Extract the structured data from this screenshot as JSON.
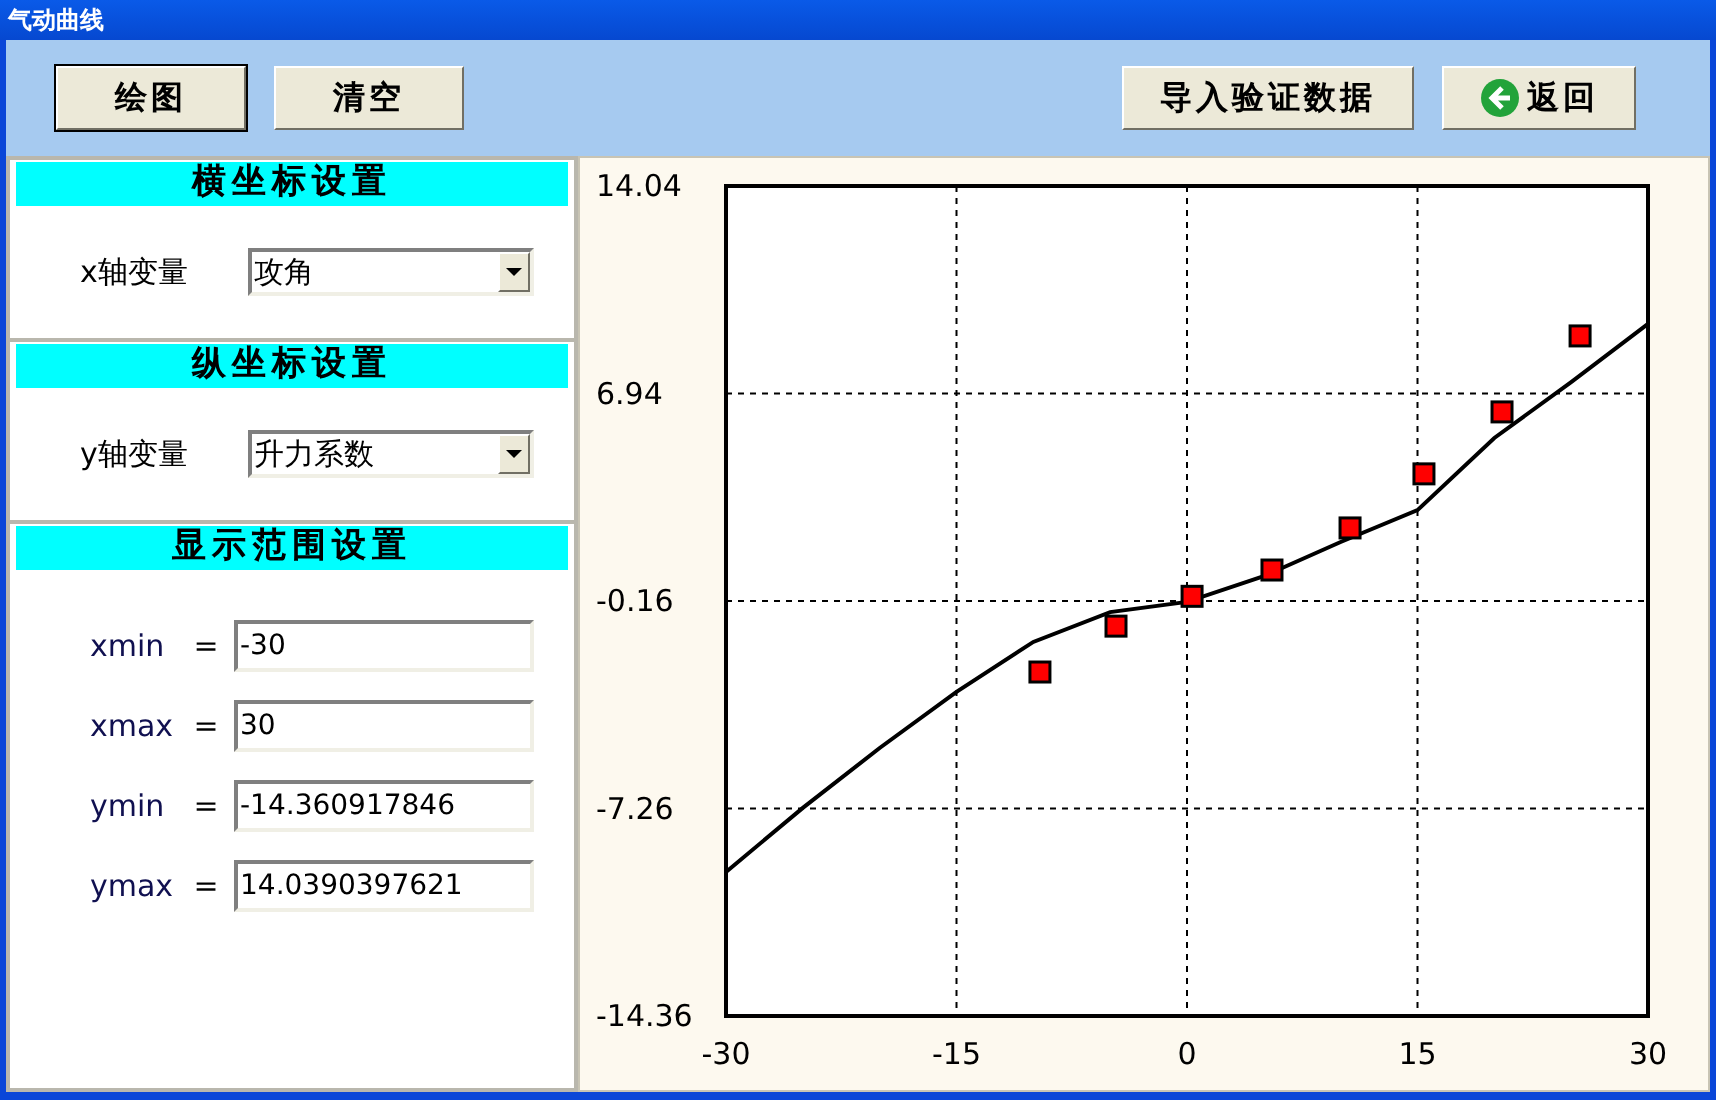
{
  "window": {
    "title": "气动曲线"
  },
  "toolbar": {
    "left_buttons": [
      {
        "label": "绘图",
        "focused": true
      },
      {
        "label": "清空",
        "focused": false
      }
    ],
    "right_buttons": [
      {
        "label": "导入验证数据",
        "icon": false
      },
      {
        "label": "返回",
        "icon": true
      }
    ]
  },
  "sections": [
    {
      "title": "横坐标设置",
      "kind": "select",
      "label": "x轴变量",
      "value": "攻角"
    },
    {
      "title": "纵坐标设置",
      "kind": "select",
      "label": "y轴变量",
      "value": "升力系数"
    },
    {
      "title": "显示范围设置",
      "kind": "range",
      "fields": [
        {
          "label": "xmin",
          "equals": "=",
          "value": "-30"
        },
        {
          "label": "xmax",
          "equals": "=",
          "value": "30"
        },
        {
          "label": "ymin",
          "equals": "=",
          "value": "-14.360917846"
        },
        {
          "label": "ymax",
          "equals": "=",
          "value": "14.0390397621"
        }
      ]
    }
  ],
  "chart_data": {
    "type": "line",
    "grid": true,
    "xlim": [
      -30,
      30
    ],
    "ylim": [
      -14.36,
      14.04
    ],
    "xticks": [
      -30,
      -15,
      0,
      15,
      30
    ],
    "yticks": [
      {
        "value": 14.04,
        "label": "14.04"
      },
      {
        "value": 6.94,
        "label": "6.94"
      },
      {
        "value": -0.16,
        "label": "-0.16"
      },
      {
        "value": -7.26,
        "label": "-7.26"
      },
      {
        "value": -14.36,
        "label": "-14.36"
      }
    ],
    "series": [
      {
        "type": "line",
        "color": "#000000",
        "x": [
          -30,
          -25,
          -20,
          -15,
          -10,
          -5,
          0,
          5,
          10,
          15,
          20,
          25,
          30
        ],
        "values": [
          -9.43,
          -7.24,
          -5.19,
          -3.27,
          -1.56,
          -0.54,
          -0.19,
          0.69,
          1.86,
          2.95,
          5.42,
          7.33,
          9.32
        ]
      },
      {
        "type": "scatter",
        "color": "#ff0000",
        "x": [
          -9.57,
          -4.62,
          0.33,
          5.53,
          10.61,
          15.42,
          20.5,
          25.58
        ],
        "values": [
          -2.59,
          -1.02,
          0.0,
          0.9,
          2.34,
          4.19,
          6.31,
          8.91
        ]
      }
    ]
  }
}
